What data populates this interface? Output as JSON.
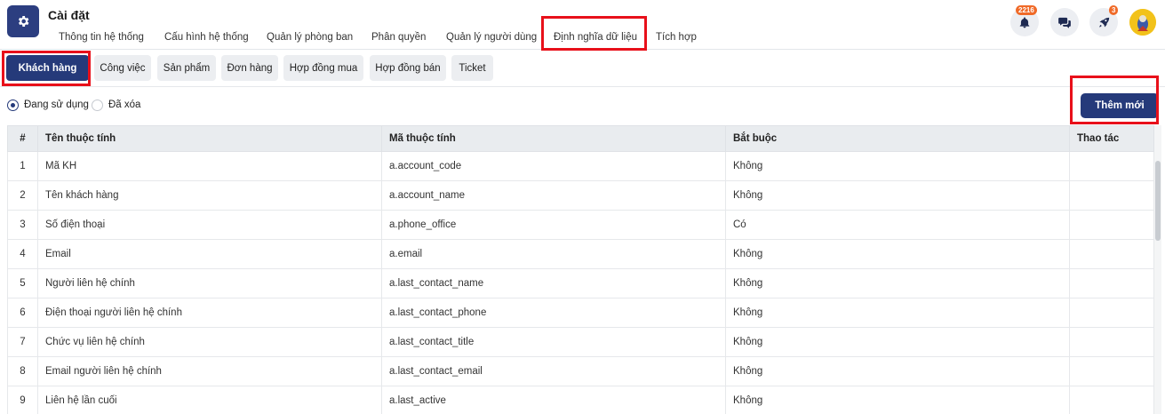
{
  "app": {
    "title": "Cài đặt",
    "icon": "gear-icon",
    "accent": "#253a7a"
  },
  "top_tabs": [
    {
      "label": "Thông tin hệ thống"
    },
    {
      "label": "Cấu hình hệ thống"
    },
    {
      "label": "Quản lý phòng ban"
    },
    {
      "label": "Phân quyền"
    },
    {
      "label": "Quản lý người dùng"
    },
    {
      "label": "Định nghĩa dữ liệu",
      "active": true
    },
    {
      "label": "Tích hợp"
    }
  ],
  "header_actions": {
    "notifications": {
      "icon": "bell-icon",
      "badge": "2216"
    },
    "chat": {
      "icon": "chat-icon"
    },
    "rocket": {
      "icon": "rocket-icon",
      "badge": "3"
    },
    "avatar": {
      "icon": "avatar"
    }
  },
  "sub_tabs": [
    {
      "label": "Khách hàng",
      "active": true
    },
    {
      "label": "Công việc"
    },
    {
      "label": "Sản phẩm"
    },
    {
      "label": "Đơn hàng"
    },
    {
      "label": "Hợp đồng mua"
    },
    {
      "label": "Hợp đồng bán"
    },
    {
      "label": "Ticket"
    }
  ],
  "filter": {
    "options": [
      {
        "label": "Đang sử dụng",
        "selected": true
      },
      {
        "label": "Đã xóa",
        "selected": false
      }
    ]
  },
  "add_button": {
    "label": "Thêm mới"
  },
  "table": {
    "columns": [
      "#",
      "Tên thuộc tính",
      "Mã thuộc tính",
      "Bắt buộc",
      "Thao tác"
    ],
    "rows": [
      {
        "num": "1",
        "name": "Mã KH",
        "code": "a.account_code",
        "required": "Không",
        "action": ""
      },
      {
        "num": "2",
        "name": "Tên khách hàng",
        "code": "a.account_name",
        "required": "Không",
        "action": ""
      },
      {
        "num": "3",
        "name": "Số điện thoại",
        "code": "a.phone_office",
        "required": "Có",
        "action": ""
      },
      {
        "num": "4",
        "name": "Email",
        "code": "a.email",
        "required": "Không",
        "action": ""
      },
      {
        "num": "5",
        "name": "Người liên hệ chính",
        "code": "a.last_contact_name",
        "required": "Không",
        "action": ""
      },
      {
        "num": "6",
        "name": "Điện thoại người liên hệ chính",
        "code": "a.last_contact_phone",
        "required": "Không",
        "action": ""
      },
      {
        "num": "7",
        "name": "Chức vụ liên hệ chính",
        "code": "a.last_contact_title",
        "required": "Không",
        "action": ""
      },
      {
        "num": "8",
        "name": "Email người liên hệ chính",
        "code": "a.last_contact_email",
        "required": "Không",
        "action": ""
      },
      {
        "num": "9",
        "name": "Liên hệ lần cuối",
        "code": "a.last_active",
        "required": "Không",
        "action": ""
      }
    ]
  }
}
